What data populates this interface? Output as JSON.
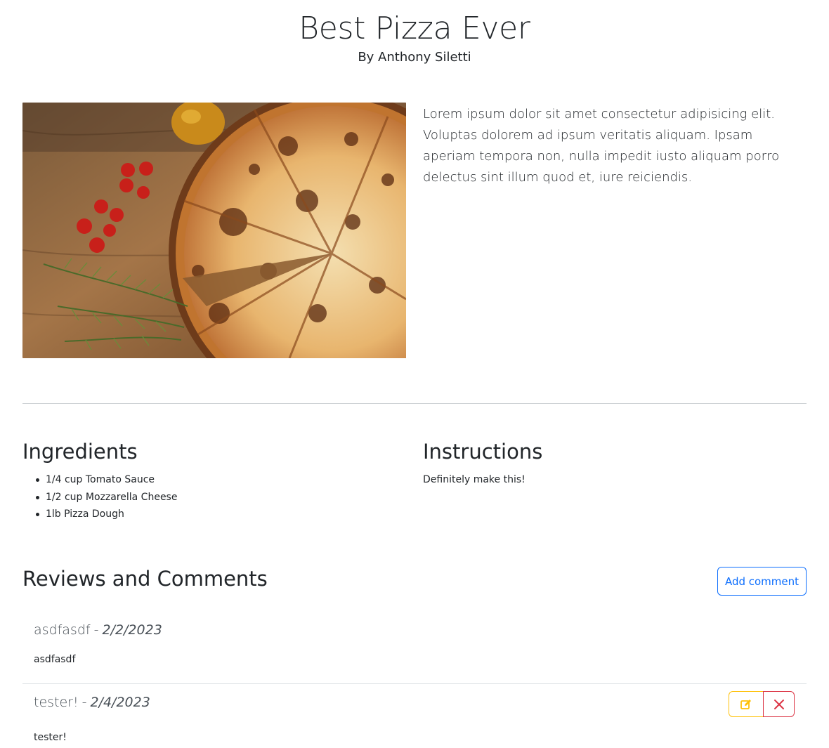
{
  "recipe": {
    "title": "Best Pizza Ever",
    "author": "By Anthony Siletti",
    "description": "Lorem ipsum dolor sit amet consectetur adipisicing elit. Voluptas dolorem ad ipsum veritatis aliquam. Ipsam aperiam tempora non, nulla impedit iusto aliquam porro delectus sint illum quod et, iure reiciendis.",
    "image_icon": "pizza-photo"
  },
  "ingredients": {
    "title": "Ingredients",
    "items": [
      "1/4 cup Tomato Sauce",
      "1/2 cup Mozzarella Cheese",
      "1lb Pizza Dough"
    ]
  },
  "instructions": {
    "title": "Instructions",
    "text": "Definitely make this!"
  },
  "reviews": {
    "title": "Reviews and Comments",
    "add_label": "Add comment",
    "separator": "-",
    "comments": [
      {
        "author": "asdfasdf",
        "date": "2/2/2023",
        "body": "asdfasdf"
      },
      {
        "author": "tester!",
        "date": "2/4/2023",
        "body": "tester!"
      }
    ]
  },
  "colors": {
    "primary": "#0d6efd",
    "warning": "#ffc107",
    "danger": "#dc3545"
  },
  "icons": {
    "edit": "edit-icon",
    "delete": "close-icon"
  }
}
